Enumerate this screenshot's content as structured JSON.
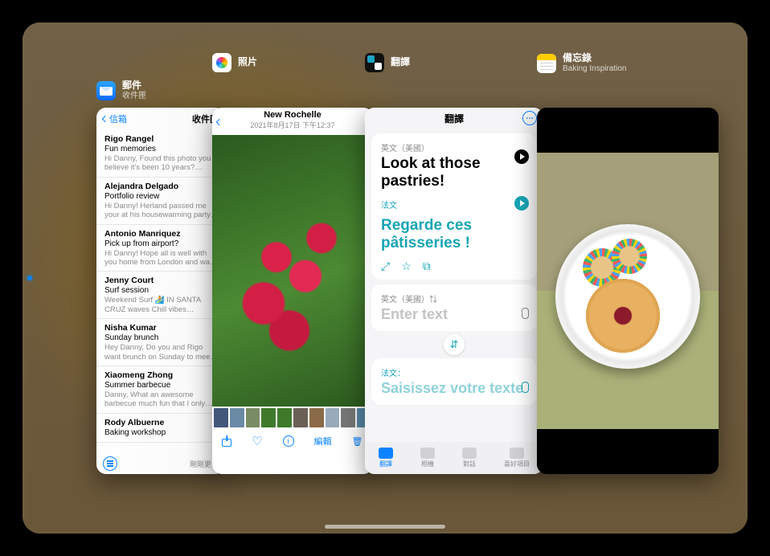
{
  "apps": {
    "mail": {
      "name": "郵件",
      "subtitle": "收件匣"
    },
    "photos": {
      "name": "照片",
      "subtitle": ""
    },
    "translate": {
      "name": "翻譯",
      "subtitle": ""
    },
    "notes": {
      "name": "備忘錄",
      "subtitle": "Baking Inspiration"
    }
  },
  "mail": {
    "back_label": "信箱",
    "title": "收件匣",
    "footer_update": "剛剛更新",
    "messages": [
      {
        "from": "Rigo Rangel",
        "subject": "Fun memories",
        "preview": "Hi Danny, Found this photo you believe it's been 10 years? Let's…"
      },
      {
        "from": "Alejandra Delgado",
        "subject": "Portfolio review",
        "preview": "Hi Danny! Herland passed me your at his housewarming party last w…"
      },
      {
        "from": "Antonio Manriquez",
        "subject": "Pick up from airport?",
        "preview": "Hi Danny! Hope all is well with you home from London and was wond…"
      },
      {
        "from": "Jenny Court",
        "subject": "Surf session",
        "preview": "Weekend Surf 🏄 IN SANTA CRUZ waves Chill vibes Delicious snac…"
      },
      {
        "from": "Nisha Kumar",
        "subject": "Sunday brunch",
        "preview": "Hey Danny, Do you and Rigo want brunch on Sunday to meet my d…"
      },
      {
        "from": "Xiaomeng Zhong",
        "subject": "Summer barbecue",
        "preview": "Danny, What an awesome barbecue much fun that I only remember…"
      },
      {
        "from": "Rody Albuerne",
        "subject": "Baking workshop",
        "preview": ""
      }
    ]
  },
  "photos": {
    "location": "New Rochelle",
    "datetime": "2021年8月17日 下午12:37",
    "edit_label": "編輯"
  },
  "translate": {
    "title": "翻譯",
    "src_lang_label": "英文（美國）",
    "dst_lang_label": "法文",
    "src_text": "Look at those pastries!",
    "dst_text": "Regarde ces pâtisseries !",
    "input_lang_label": "英文（美國）⇅",
    "input_placeholder": "Enter text",
    "input_fr_label": "法文：",
    "input_fr_placeholder": "Saisissez votre texte",
    "tabs": [
      "翻譯",
      "相機",
      "對話",
      "喜好項目"
    ]
  }
}
